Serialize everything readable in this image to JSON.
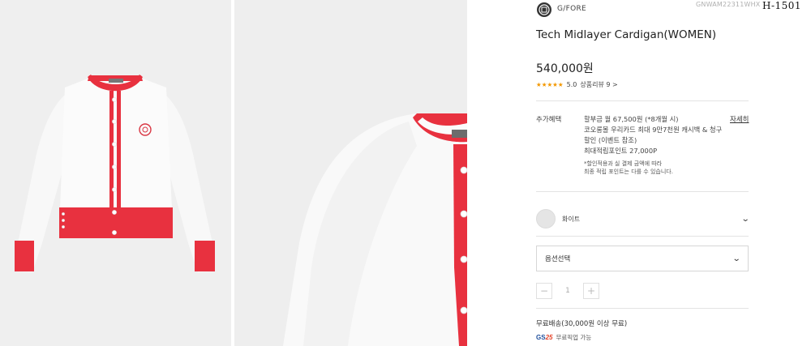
{
  "gallery": {
    "images": [
      {
        "alt": "Tech Midlayer Cardigan front view"
      },
      {
        "alt": "Tech Midlayer Cardigan detail close-up"
      }
    ]
  },
  "product": {
    "brand": "G/FORE",
    "sku": "GNWAM22311WHX",
    "stamp": "H-1501",
    "title": "Tech Midlayer Cardigan(WOMEN)",
    "price": "540,000원",
    "rating_stars": "★★★★★",
    "rating_value": "5.0",
    "review_link": "상품리뷰 9 >"
  },
  "benefits": {
    "label": "추가혜택",
    "lines": [
      "할부금 월 67,500원 (*8개월 시)",
      "코오롱몰 우리카드 최대 9만7천원 캐시백 & 청구",
      "할인 (이벤트 참조)",
      "최대적립포인트 27,000P"
    ],
    "note_lines": [
      "*할인적용과 실 결제 금액에 따라",
      "최종 적립 포인트는 다를 수 있습니다."
    ],
    "detail_link": "자세히"
  },
  "options": {
    "color_name": "화이트",
    "select_label": "옵션선택",
    "quantity": "1"
  },
  "shipping": {
    "text": "무료배송(30,000원 이상 무료)",
    "gs_logo_text": "GS",
    "gs_logo_num": "25",
    "gs_text": "무료픽업 가능"
  },
  "colors": {
    "accent_red": "#e8313f",
    "star_orange": "#f39800",
    "sweater_white": "#fafafa"
  }
}
